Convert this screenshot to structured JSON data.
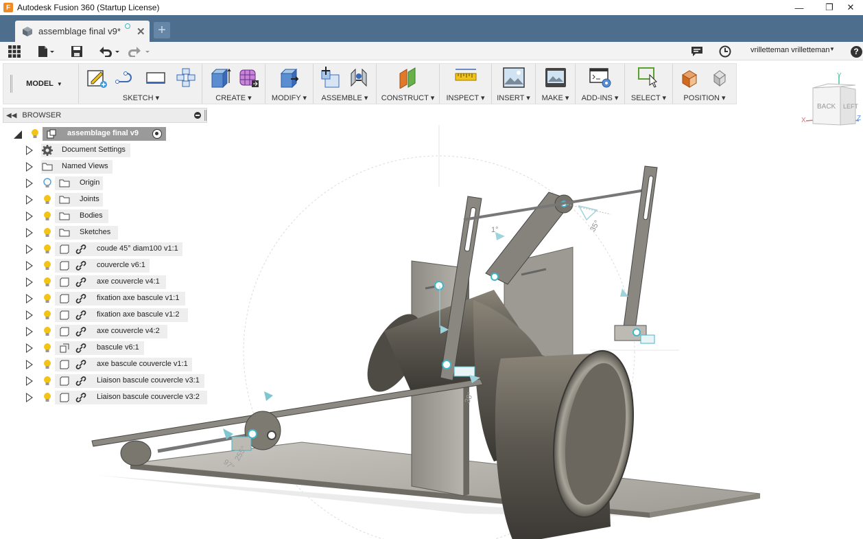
{
  "window": {
    "title": "Autodesk Fusion 360 (Startup License)",
    "app_icon_letter": "F",
    "minimize": "—",
    "restore": "❐",
    "close": "✕"
  },
  "tab": {
    "label": "assemblage final v9*",
    "close": "✕",
    "new_tab": "+"
  },
  "quick_access": {
    "user": "vrilletteman vrilletteman",
    "help": "?"
  },
  "toolbar": {
    "workspace": "MODEL",
    "groups": {
      "sketch": "SKETCH ▾",
      "create": "CREATE ▾",
      "modify": "MODIFY ▾",
      "assemble": "ASSEMBLE ▾",
      "construct": "CONSTRUCT ▾",
      "inspect": "INSPECT ▾",
      "insert": "INSERT ▾",
      "make": "MAKE ▾",
      "addins": "ADD-INS ▾",
      "select": "SELECT ▾",
      "position": "POSITION ▾"
    }
  },
  "viewcube": {
    "back": "BACK",
    "left": "LEFT",
    "axis_x": "X",
    "axis_y": "Y",
    "axis_z": "Z"
  },
  "browser": {
    "title": "BROWSER",
    "root": "assemblage final v9",
    "items": [
      {
        "label": "Document Settings"
      },
      {
        "label": "Named Views"
      },
      {
        "label": "Origin"
      },
      {
        "label": "Joints"
      },
      {
        "label": "Bodies"
      },
      {
        "label": "Sketches"
      },
      {
        "label": "coude 45° diam100 v1:1"
      },
      {
        "label": "couvercle v6:1"
      },
      {
        "label": "axe couvercle v4:1"
      },
      {
        "label": "fixation axe bascule v1:1"
      },
      {
        "label": "fixation axe bascule v1:2"
      },
      {
        "label": "axe couvercle v4:2"
      },
      {
        "label": "bascule v6:1"
      },
      {
        "label": "axe bascule couvercle v1:1"
      },
      {
        "label": "Liaison bascule couvercle v3:1"
      },
      {
        "label": "Liaison bascule couvercle v3:2"
      }
    ]
  },
  "viewport_labels": {
    "angle_35": "35°",
    "angle_1": "1°",
    "angle_38": "38°",
    "angle_97": "97°",
    "angle_255": "255°"
  },
  "colors": {
    "tab_bar": "#4e6e8e",
    "accent_teal": "#40b6c8",
    "bulb_yellow": "#f2c318",
    "bulb_blue": "#5aa0d8"
  }
}
